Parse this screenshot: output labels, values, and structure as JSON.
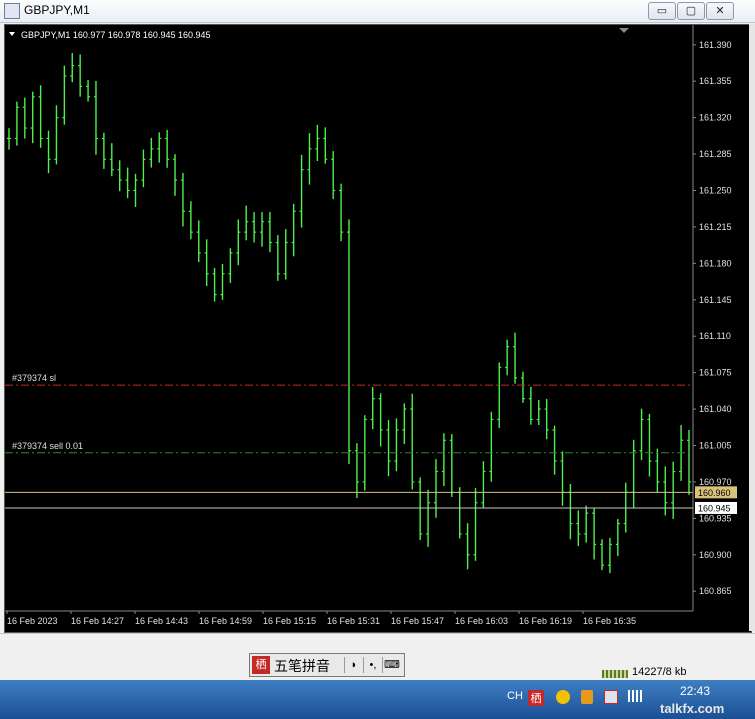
{
  "window": {
    "title": "GBPJPY,M1",
    "min_glyph": "▭",
    "restore_glyph": "▢",
    "close_glyph": "✕"
  },
  "chart_data": {
    "type": "bar",
    "title": "GBPJPY,M1  160.977 160.978 160.945 160.945",
    "symbol": "GBPJPY,M1",
    "ohlc_header": [
      "160.977",
      "160.978",
      "160.945",
      "160.945"
    ],
    "ylim": [
      160.846,
      161.409
    ],
    "y_ticks": [
      "161.390",
      "161.355",
      "161.320",
      "161.285",
      "161.250",
      "161.215",
      "161.180",
      "161.145",
      "161.110",
      "161.075",
      "161.040",
      "161.005",
      "160.970",
      "160.935",
      "160.900",
      "160.865"
    ],
    "x_ticks": [
      "16 Feb 2023",
      "16 Feb 14:27",
      "16 Feb 14:43",
      "16 Feb 14:59",
      "16 Feb 15:15",
      "16 Feb 15:31",
      "16 Feb 15:47",
      "16 Feb 16:03",
      "16 Feb 16:19",
      "16 Feb 16:35"
    ],
    "price_path": [
      161.3,
      161.33,
      161.31,
      161.34,
      161.3,
      161.28,
      161.32,
      161.36,
      161.37,
      161.35,
      161.34,
      161.3,
      161.28,
      161.27,
      161.26,
      161.25,
      161.26,
      161.28,
      161.29,
      161.3,
      161.28,
      161.26,
      161.23,
      161.21,
      161.19,
      161.17,
      161.15,
      161.17,
      161.19,
      161.21,
      161.22,
      161.21,
      161.22,
      161.2,
      161.17,
      161.2,
      161.23,
      161.27,
      161.29,
      161.3,
      161.28,
      161.25,
      161.21,
      161.0,
      160.97,
      161.03,
      161.05,
      161.02,
      160.99,
      161.02,
      161.04,
      160.97,
      160.92,
      160.95,
      160.98,
      161.01,
      160.96,
      160.92,
      160.9,
      160.95,
      160.98,
      161.03,
      161.08,
      161.1,
      161.07,
      161.05,
      161.03,
      161.04,
      161.02,
      160.99,
      160.96,
      160.93,
      160.92,
      160.94,
      160.91,
      160.89,
      160.91,
      160.93,
      160.96,
      161.0,
      161.03,
      160.99,
      160.97,
      160.95,
      160.98,
      161.01,
      160.97
    ],
    "lines": [
      {
        "label": "#379374 sl",
        "price": 161.063,
        "color": "#c62828",
        "style": "dashdot"
      },
      {
        "label": "#379374 sell 0.01",
        "price": 160.998,
        "color": "#2e8b2e",
        "style": "dashdot"
      },
      {
        "price": 160.96,
        "color": "#d9c27a",
        "style": "solid"
      },
      {
        "price": 160.945,
        "color": "#c8c8c8",
        "style": "solid"
      }
    ],
    "price_labels": [
      {
        "text": "160.960",
        "price": 160.96,
        "bg": "#d9c27a",
        "fg": "#000000"
      },
      {
        "text": "160.945",
        "price": 160.945,
        "bg": "#ffffff",
        "fg": "#000000"
      }
    ],
    "bar_color": "#4ef04e",
    "background": "#000000",
    "grid": false
  },
  "ime": {
    "icon_label": "栖",
    "text": "五笔拼音",
    "seg1": "◗",
    "seg2": "•,",
    "seg3": "⌨"
  },
  "netspeed": {
    "text": "14227/8 kb"
  },
  "tray": {
    "lang": "CH",
    "clock": "22:43",
    "ime_tray_icon": "栖"
  },
  "watermark": "talkfx.com"
}
